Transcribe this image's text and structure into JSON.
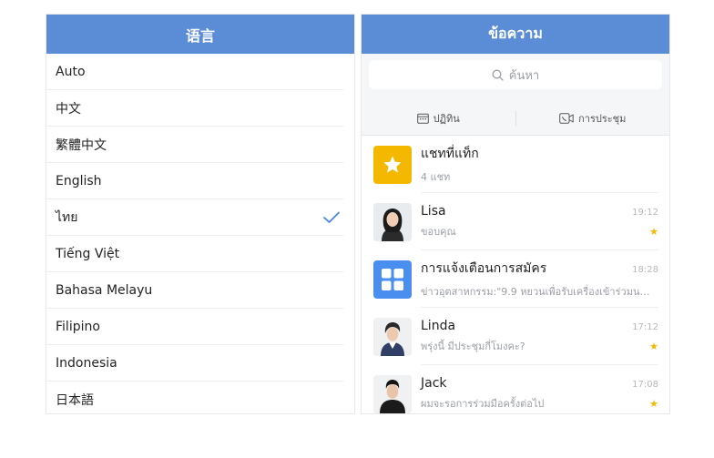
{
  "language_panel": {
    "title": "语言",
    "selected": "ไทย",
    "items": [
      "Auto",
      "中文",
      "繁體中文",
      "English",
      "ไทย",
      "Tiếng Việt",
      "Bahasa Melayu",
      "Filipino",
      "Indonesia",
      "日本語"
    ]
  },
  "messages_panel": {
    "title": "ข้อความ",
    "search": {
      "placeholder": "ค้นหา"
    },
    "quick_actions": {
      "calendar_label": "ปฏิทิน",
      "meeting_label": "การประชุม"
    },
    "conversations": [
      {
        "name": "แชทที่แท็ก",
        "preview": "4 แชท",
        "time": "",
        "starred": false,
        "avatar": "star-icon"
      },
      {
        "name": "Lisa",
        "preview": "ขอบคุณ",
        "time": "19:12",
        "starred": true,
        "avatar": "avatar-photo"
      },
      {
        "name": "การแจ้งเตือนการสมัคร",
        "preview": "ข่าวอุตสาหกรรม:\"9.9 หยวนเพื่อรับเครื่องเข้าร่วมนลู...",
        "time": "18:28",
        "starred": false,
        "avatar": "apps-grid-icon"
      },
      {
        "name": "Linda",
        "preview": "พรุ่งนี้ มีประชุมกี่โมงคะ?",
        "time": "17:12",
        "starred": true,
        "avatar": "avatar-photo"
      },
      {
        "name": "Jack",
        "preview": "ผมจะรอการร่วมมือครั้งต่อไป",
        "time": "17:08",
        "starred": true,
        "avatar": "avatar-photo"
      }
    ]
  },
  "colors": {
    "header": "#5b8cd6",
    "check": "#4a86e8",
    "star_tile": "#f5b800",
    "apps_tile": "#4a8ef0"
  }
}
